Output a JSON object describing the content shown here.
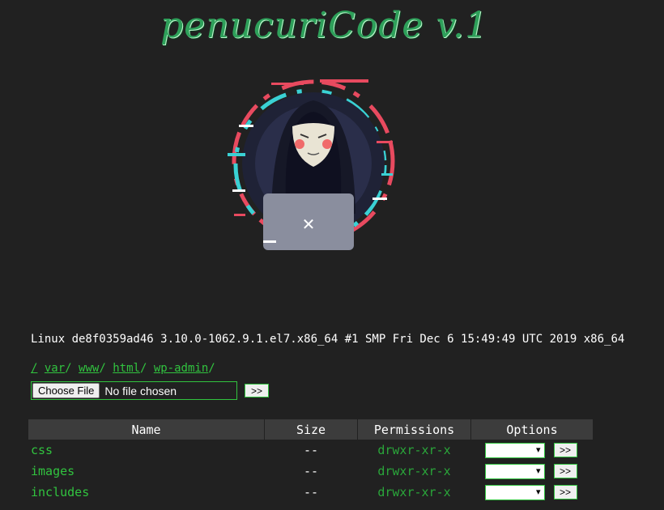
{
  "header": {
    "title": "penucuriCode v.1"
  },
  "logo": {
    "icon": "hacker-mask-logo-icon",
    "colors": {
      "glitch_red": "#e84a5f",
      "glitch_cyan": "#3ad1d4",
      "hood": "#1f2236",
      "laptop": "#8a8e9e"
    }
  },
  "system": {
    "uname": "Linux de8f0359ad46 3.10.0-1062.9.1.el7.x86_64 #1 SMP Fri Dec 6 15:49:49 UTC 2019 x86_64"
  },
  "path": {
    "root": "/",
    "segments": [
      "var",
      "www",
      "html",
      "wp-admin"
    ],
    "sep": "/"
  },
  "upload": {
    "choose_label": "Choose File",
    "file_status": "No file chosen",
    "submit_label": ">>"
  },
  "table": {
    "headers": {
      "name": "Name",
      "size": "Size",
      "permissions": "Permissions",
      "options": "Options"
    },
    "rows": [
      {
        "name": "css",
        "size": "--",
        "permissions": "drwxr-xr-x",
        "option_value": "",
        "go_label": ">>"
      },
      {
        "name": "images",
        "size": "--",
        "permissions": "drwxr-xr-x",
        "option_value": "",
        "go_label": ">>"
      },
      {
        "name": "includes",
        "size": "--",
        "permissions": "drwxr-xr-x",
        "option_value": "",
        "go_label": ">>"
      }
    ]
  },
  "theme": {
    "background": "#212121",
    "accent_green": "#31c33f",
    "header_bg": "#3c3c3c"
  }
}
